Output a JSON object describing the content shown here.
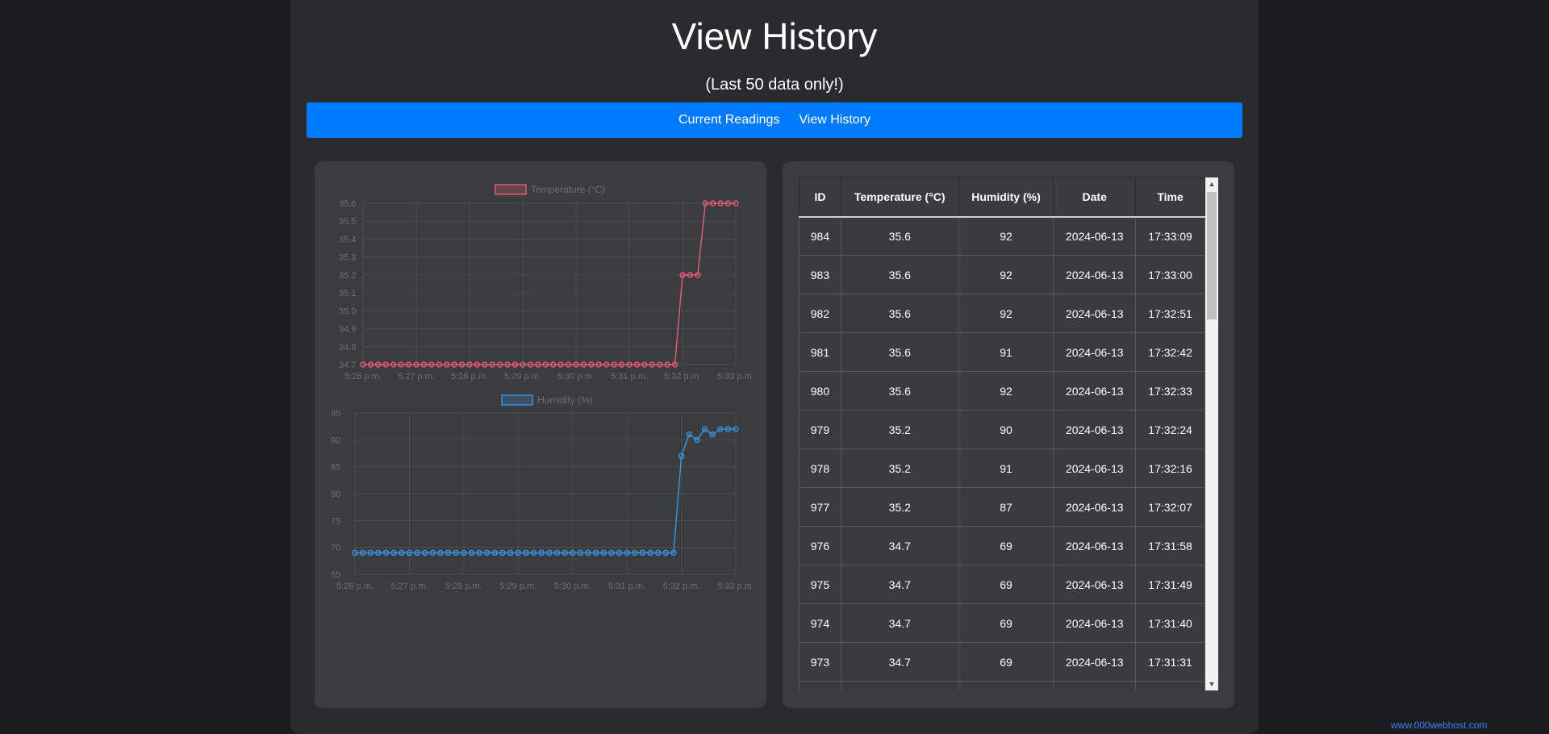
{
  "page": {
    "title": "View History",
    "subtitle": "(Last 50 data only!)"
  },
  "nav": {
    "items": [
      {
        "label": "Current Readings"
      },
      {
        "label": "View History"
      }
    ]
  },
  "colors": {
    "temperature": "#e05a73",
    "humidity": "#3b8fd9",
    "nav_bg": "#007bff"
  },
  "chart_data": [
    {
      "type": "line",
      "legend": "Temperature (°C)",
      "ylim": [
        34.7,
        35.6
      ],
      "yticks": [
        "35.6",
        "35.5",
        "35.4",
        "35.3",
        "35.2",
        "35.1",
        "35.0",
        "34.9",
        "34.8",
        "34.7"
      ],
      "xticks": [
        "5:26 p.m.",
        "5:27 p.m.",
        "5:28 p.m.",
        "5:29 p.m.",
        "5:30 p.m.",
        "5:31 p.m.",
        "5:32 p.m.",
        "5:33 p.m."
      ],
      "values": [
        34.7,
        34.7,
        34.7,
        34.7,
        34.7,
        34.7,
        34.7,
        34.7,
        34.7,
        34.7,
        34.7,
        34.7,
        34.7,
        34.7,
        34.7,
        34.7,
        34.7,
        34.7,
        34.7,
        34.7,
        34.7,
        34.7,
        34.7,
        34.7,
        34.7,
        34.7,
        34.7,
        34.7,
        34.7,
        34.7,
        34.7,
        34.7,
        34.7,
        34.7,
        34.7,
        34.7,
        34.7,
        34.7,
        34.7,
        34.7,
        34.7,
        34.7,
        35.2,
        35.2,
        35.2,
        35.6,
        35.6,
        35.6,
        35.6,
        35.6
      ]
    },
    {
      "type": "line",
      "legend": "Humidity (%)",
      "ylim": [
        65,
        95
      ],
      "yticks": [
        "95",
        "90",
        "85",
        "80",
        "75",
        "70",
        "65"
      ],
      "xticks": [
        "5:26 p.m.",
        "5:27 p.m.",
        "5:28 p.m.",
        "5:29 p.m.",
        "5:30 p.m.",
        "5:31 p.m.",
        "5:32 p.m.",
        "5:33 p.m."
      ],
      "values": [
        69,
        69,
        69,
        69,
        69,
        69,
        69,
        69,
        69,
        69,
        69,
        69,
        69,
        69,
        69,
        69,
        69,
        69,
        69,
        69,
        69,
        69,
        69,
        69,
        69,
        69,
        69,
        69,
        69,
        69,
        69,
        69,
        69,
        69,
        69,
        69,
        69,
        69,
        69,
        69,
        69,
        69,
        87,
        91,
        90,
        92,
        91,
        92,
        92,
        92
      ]
    }
  ],
  "table": {
    "headers": [
      "ID",
      "Temperature (°C)",
      "Humidity (%)",
      "Date",
      "Time"
    ],
    "rows": [
      [
        "984",
        "35.6",
        "92",
        "2024-06-13",
        "17:33:09"
      ],
      [
        "983",
        "35.6",
        "92",
        "2024-06-13",
        "17:33:00"
      ],
      [
        "982",
        "35.6",
        "92",
        "2024-06-13",
        "17:32:51"
      ],
      [
        "981",
        "35.6",
        "91",
        "2024-06-13",
        "17:32:42"
      ],
      [
        "980",
        "35.6",
        "92",
        "2024-06-13",
        "17:32:33"
      ],
      [
        "979",
        "35.2",
        "90",
        "2024-06-13",
        "17:32:24"
      ],
      [
        "978",
        "35.2",
        "91",
        "2024-06-13",
        "17:32:16"
      ],
      [
        "977",
        "35.2",
        "87",
        "2024-06-13",
        "17:32:07"
      ],
      [
        "976",
        "34.7",
        "69",
        "2024-06-13",
        "17:31:58"
      ],
      [
        "975",
        "34.7",
        "69",
        "2024-06-13",
        "17:31:49"
      ],
      [
        "974",
        "34.7",
        "69",
        "2024-06-13",
        "17:31:40"
      ],
      [
        "973",
        "34.7",
        "69",
        "2024-06-13",
        "17:31:31"
      ],
      [
        "",
        "",
        "",
        "",
        ""
      ]
    ]
  },
  "badge": {
    "text": "www.000webhost.com"
  }
}
